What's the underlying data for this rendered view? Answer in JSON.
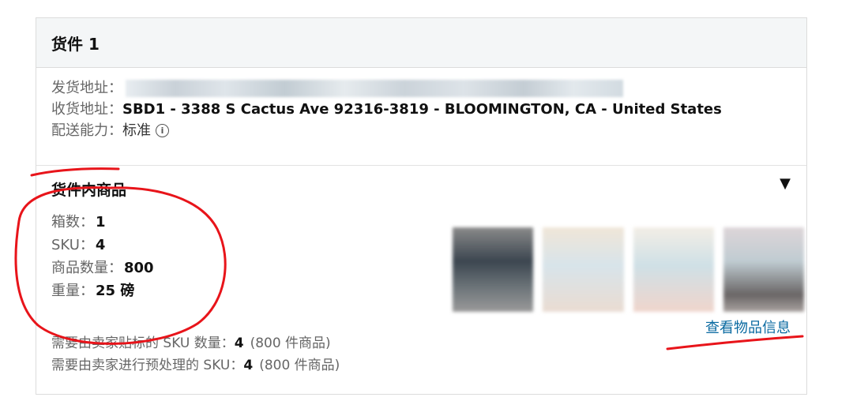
{
  "shipment": {
    "title": "货件 1",
    "ship_from_label": "发货地址：",
    "ship_to_label": "收货地址：",
    "ship_to_value": "SBD1 - 3388 S Cactus Ave 92316-3819 - BLOOMINGTON, CA - United States",
    "capability_label": "配送能力：",
    "capability_value": "标准"
  },
  "items": {
    "title": "货件内商品",
    "stats": [
      {
        "label": "箱数：",
        "value": "1"
      },
      {
        "label": "SKU：",
        "value": "4"
      },
      {
        "label": "商品数量：",
        "value": "800"
      },
      {
        "label": "重量：",
        "value": "25 磅"
      }
    ],
    "seller_label_rows": [
      {
        "label": "需要由卖家贴标的 SKU 数量：",
        "value": "4",
        "paren": "(800 件商品)"
      },
      {
        "label": "需要由卖家进行预处理的 SKU：",
        "value": "4",
        "paren": "(800 件商品)"
      }
    ],
    "view_link": "查看物品信息"
  },
  "icons": {
    "info": "info-circle-icon",
    "caret": "caret-down-icon"
  },
  "colors": {
    "link": "#0a6aa1",
    "annotation": "#e8141a",
    "header_bg": "#f4f6f7"
  }
}
